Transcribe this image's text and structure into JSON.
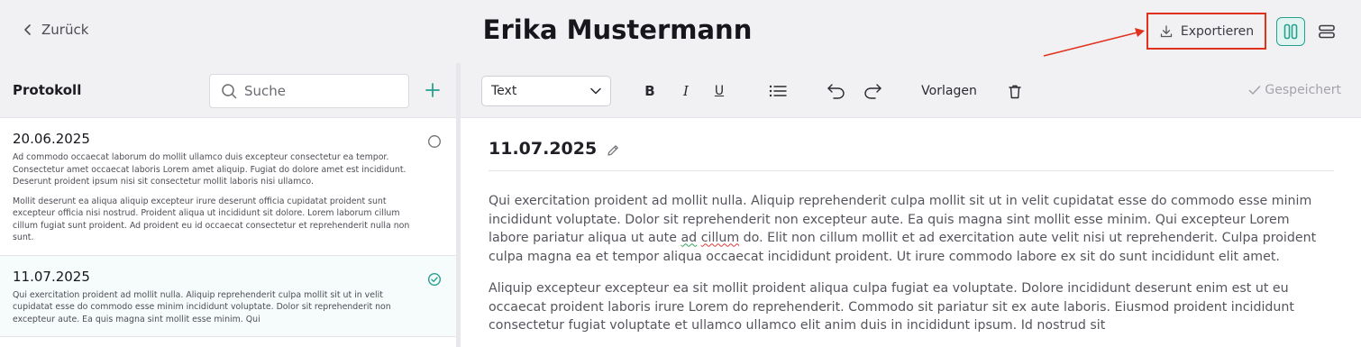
{
  "header": {
    "back_label": "Zurück",
    "title": "Erika Mustermann",
    "export_label": "Exportieren",
    "accent_color": "#27a08e",
    "highlight_color": "#e0301e"
  },
  "sidebar": {
    "heading": "Protokoll",
    "search_placeholder": "Suche",
    "entries": [
      {
        "date": "20.06.2025",
        "status": "open",
        "paragraphs": [
          "Ad commodo occaecat laborum do mollit ullamco duis excepteur consectetur ea tempor. Consectetur amet occaecat laboris Lorem amet aliquip. Fugiat do dolore amet est incididunt. Deserunt proident ipsum nisi sit consectetur mollit laboris nisi ullamco.",
          "Mollit deserunt ea aliqua aliquip excepteur irure deserunt officia cupidatat proident sunt excepteur officia nisi nostrud. Proident aliqua ut incididunt sit dolore. Lorem laborum cillum cillum fugiat sunt proident. Ad proident eu id occaecat consectetur et reprehenderit nulla non sunt."
        ]
      },
      {
        "date": "11.07.2025",
        "status": "done",
        "paragraphs": [
          "Qui exercitation proident ad mollit nulla. Aliquip reprehenderit culpa mollit sit ut in velit cupidatat esse do commodo esse minim incididunt voluptate. Dolor sit reprehenderit non excepteur aute. Ea quis magna sint mollit esse minim. Qui"
        ]
      }
    ]
  },
  "editor": {
    "format_select": "Text",
    "bold_label": "B",
    "italic_label": "I",
    "underline_label": "U",
    "templates_label": "Vorlagen",
    "saved_label": "Gespeichert",
    "doc_date": "11.07.2025",
    "p1_a": "Qui exercitation proident ad mollit nulla. Aliquip reprehenderit culpa mollit sit ut in velit cupidatat esse do commodo esse minim incididunt voluptate. Dolor sit reprehenderit non excepteur aute. Ea quis magna sint mollit esse minim. Qui excepteur Lorem labore pariatur aliqua ut aute ",
    "p1_w1": "ad",
    "p1_w2": "cillum",
    "p1_b": " do. Elit non cillum mollit et ad exercitation aute velit nisi ut reprehenderit. Culpa proident culpa magna ea et tempor aliqua occaecat incididunt proident. Ut irure commodo labore ex sit do sunt incididunt elit amet.",
    "p2": "Aliquip excepteur excepteur ea sit mollit proident aliqua culpa fugiat ea voluptate. Dolore incididunt deserunt enim est ut eu occaecat proident laboris irure Lorem do reprehenderit. Commodo sit pariatur sit ex aute laboris. Eiusmod proident incididunt consectetur fugiat voluptate et ullamco ullamco elit anim duis in incididunt ipsum. Id nostrud sit"
  }
}
